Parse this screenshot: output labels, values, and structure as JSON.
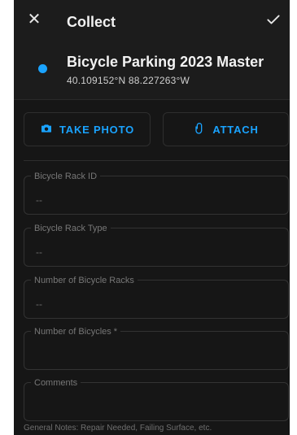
{
  "header": {
    "title": "Collect",
    "close_icon": "close-icon",
    "confirm_icon": "check-icon"
  },
  "layer": {
    "name": "Bicycle Parking 2023 Master",
    "coordinates": "40.109152°N  88.227263°W",
    "dot_color": "#1aa3ff"
  },
  "actions": {
    "take_photo": "TAKE PHOTO",
    "attach": "ATTACH",
    "accent": "#1aa3ff"
  },
  "fields": [
    {
      "label": "Bicycle Rack ID",
      "value": "--"
    },
    {
      "label": "Bicycle Rack Type",
      "value": "--"
    },
    {
      "label": "Number of Bicycle Racks",
      "value": "--"
    },
    {
      "label": "Number of Bicycles *",
      "value": ""
    },
    {
      "label": "Comments",
      "value": ""
    }
  ],
  "comments_helper": "General Notes: Repair Needed, Failing Surface, etc."
}
